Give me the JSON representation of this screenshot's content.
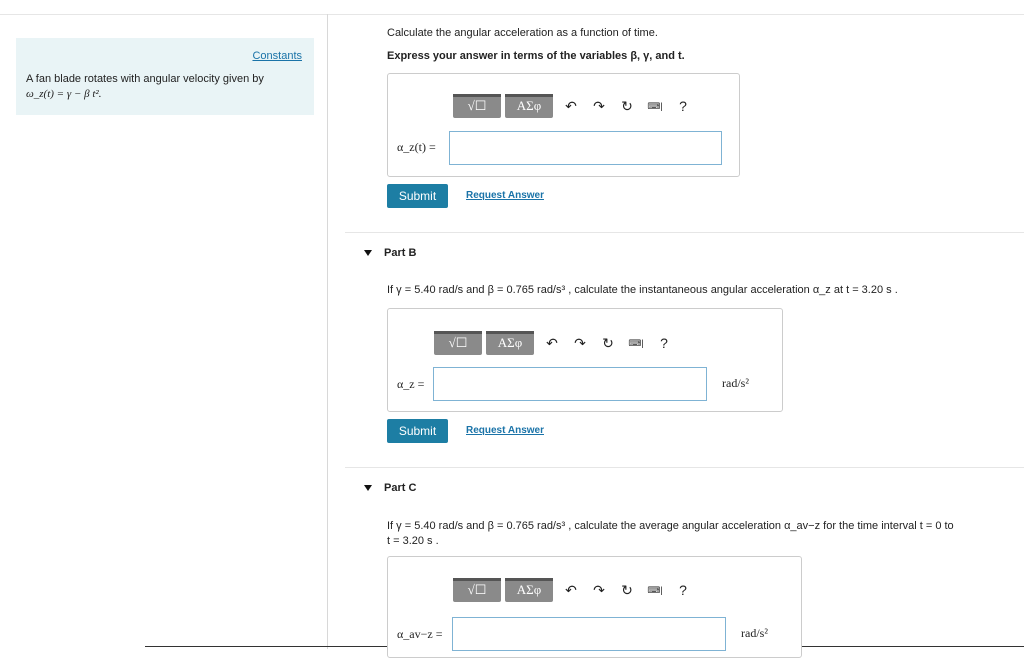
{
  "left": {
    "constants_link": "Constants",
    "problem_line1": "A fan blade rotates with angular velocity given by",
    "problem_line2": "ω_z(t) = γ − β t²."
  },
  "partA": {
    "instruction": "Calculate the angular acceleration as a function of time.",
    "express": "Express your answer in terms of the variables β, γ, and t.",
    "label": "α_z(t) =",
    "input_value": "",
    "submit": "Submit",
    "request": "Request Answer"
  },
  "partB": {
    "title": "Part B",
    "question": "If γ = 5.40 rad/s and β = 0.765 rad/s³ , calculate the instantaneous angular acceleration α_z at t = 3.20 s .",
    "label": "α_z =",
    "input_value": "",
    "unit": "rad/s²",
    "submit": "Submit",
    "request": "Request Answer"
  },
  "partC": {
    "title": "Part C",
    "question_line1": "If γ = 5.40 rad/s and β = 0.765 rad/s³ , calculate the average angular acceleration α_av−z for the time interval t = 0 to",
    "question_line2": "t = 3.20 s .",
    "label": "α_av−z =",
    "input_value": "",
    "unit": "rad/s²"
  },
  "toolbar": {
    "templates_label": "√☐",
    "greek_label": "ΑΣφ",
    "undo_icon": "undo-icon",
    "redo_icon": "redo-icon",
    "reset_icon": "reset-icon",
    "keyboard_icon": "keyboard-icon",
    "help_label": "?"
  },
  "colors": {
    "accent": "#1d7ea4",
    "link": "#1a73a8",
    "panel_bg": "#e9f4f6",
    "input_border": "#7fb3d4"
  }
}
